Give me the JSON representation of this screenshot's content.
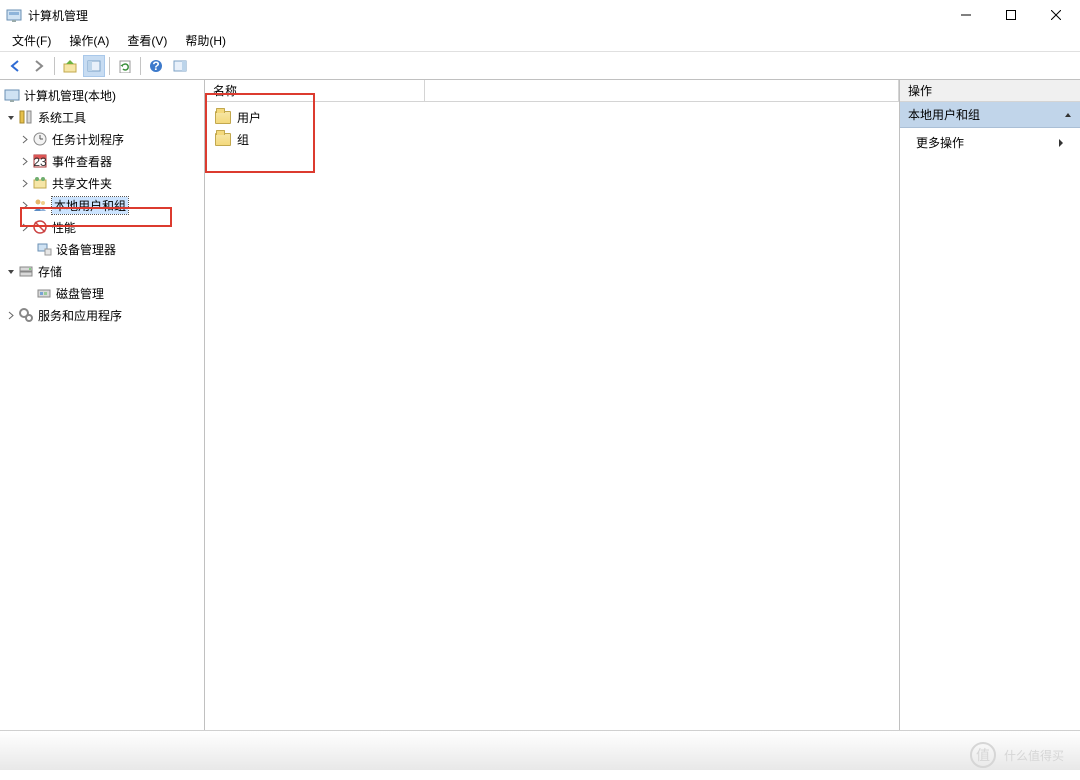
{
  "window": {
    "title": "计算机管理"
  },
  "menubar": [
    "文件(F)",
    "操作(A)",
    "查看(V)",
    "帮助(H)"
  ],
  "tree": {
    "root": "计算机管理(本地)",
    "systools": "系统工具",
    "systools_children": [
      "任务计划程序",
      "事件查看器",
      "共享文件夹",
      "本地用户和组",
      "性能",
      "设备管理器"
    ],
    "storage": "存储",
    "storage_children": [
      "磁盘管理"
    ],
    "services": "服务和应用程序"
  },
  "list": {
    "header_col": "名称",
    "items": [
      "用户",
      "组"
    ]
  },
  "actions": {
    "title": "操作",
    "section": "本地用户和组",
    "more": "更多操作"
  },
  "watermark": {
    "badge": "值",
    "text": "什么值得买"
  }
}
